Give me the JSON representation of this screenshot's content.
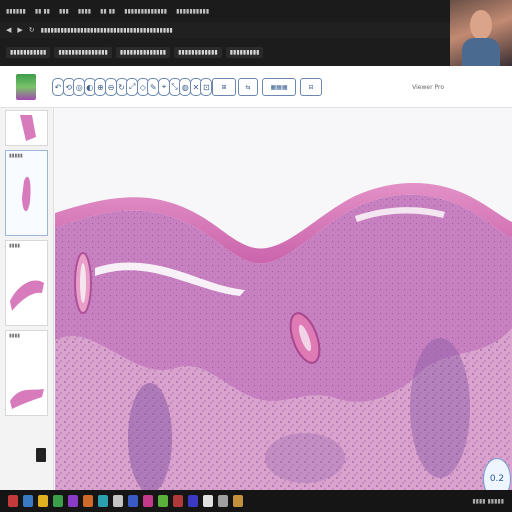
{
  "browser": {
    "menu_items": [
      "▮▮▮▮▮▮",
      "▮▮ ▮▮",
      "▮▮▮",
      "▮▮▮▮",
      "▮▮ ▮▮",
      "▮▮▮▮▮▮▮▮▮▮▮▮▮",
      "▮▮▮▮▮▮▮▮▮▮"
    ],
    "url": "▮▮▮▮▮▮▮▮▮▮▮▮▮▮▮▮▮▮▮▮▮▮▮▮▮▮▮▮▮▮▮▮▮▮▮▮▮▮▮▮",
    "bookmarks": [
      "▮▮▮▮▮▮▮▮▮▮▮",
      "▮▮▮▮▮▮▮▮▮▮▮▮▮▮▮",
      "▮▮▮▮▮▮▮▮▮▮▮▮▮▮",
      "▮▮▮▮▮▮▮▮▮▮▮▮",
      "▮▮▮▮▮▮▮▮▮"
    ]
  },
  "viewer": {
    "brand_text": "Viewer Pro",
    "tool_icons": [
      "↶",
      "⟲",
      "◎",
      "◐",
      "⊕",
      "⊖",
      "↻",
      "⤢",
      "◇",
      "✎",
      "⌖",
      "⤡",
      "◍",
      "✕",
      "⊡"
    ],
    "wide_buttons": [
      "⊞",
      "⇆",
      "▦▦▦",
      "⊟"
    ]
  },
  "thumbnails": [
    {
      "label": "",
      "selected": false
    },
    {
      "label": "▮▮▮▮▮",
      "selected": true
    },
    {
      "label": "▮▮▮▮",
      "selected": false
    },
    {
      "label": "▮▮▮▮",
      "selected": false
    }
  ],
  "zoom": {
    "label": "0.2"
  },
  "colors": {
    "stain_pink": "#d77bbd",
    "stain_purple": "#7a4a9a",
    "dermis_pink": "#d89ac8",
    "background": "#f7f6f8",
    "accent_blue": "#3b5f8f"
  },
  "taskbar": {
    "icon_colors": [
      "#c43a3a",
      "#3a7ac4",
      "#e0b020",
      "#3aa04a",
      "#8a3ac4",
      "#d06a2a",
      "#2aa0b0",
      "#c4c4c4",
      "#3a5ac4",
      "#c43a8a",
      "#5ab03a",
      "#b03a3a",
      "#3a3ac4",
      "#e0e0e0",
      "#a0a0a0",
      "#c4903a"
    ],
    "tray_text": "▮▮▮▮  ▮▮▮▮▮"
  }
}
